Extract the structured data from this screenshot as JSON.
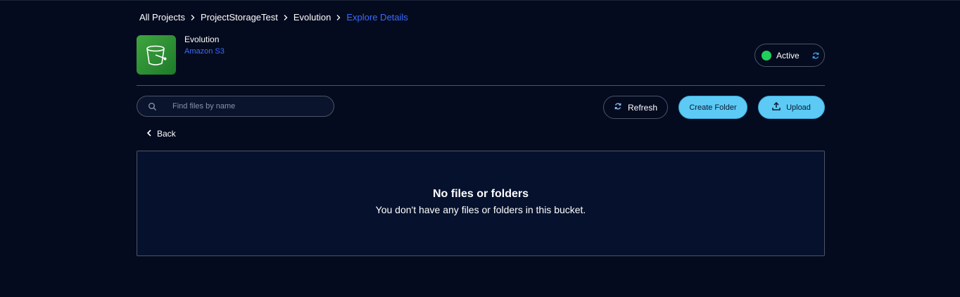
{
  "breadcrumb": {
    "items": [
      "All Projects",
      "ProjectStorageTest",
      "Evolution"
    ],
    "current": "Explore Details"
  },
  "bucket": {
    "name": "Evolution",
    "type": "Amazon S3",
    "icon": "bucket-icon"
  },
  "status": {
    "label": "Active",
    "color": "#1fd05a"
  },
  "search": {
    "placeholder": "Find files by name",
    "value": ""
  },
  "toolbar": {
    "refresh_label": "Refresh",
    "create_folder_label": "Create Folder",
    "upload_label": "Upload"
  },
  "back_label": "Back",
  "empty_state": {
    "title": "No files or folders",
    "message": "You don't have any files or folders in this bucket."
  },
  "colors": {
    "background": "#050b1f",
    "accent": "#5ccaf5",
    "link": "#3a6bff"
  }
}
